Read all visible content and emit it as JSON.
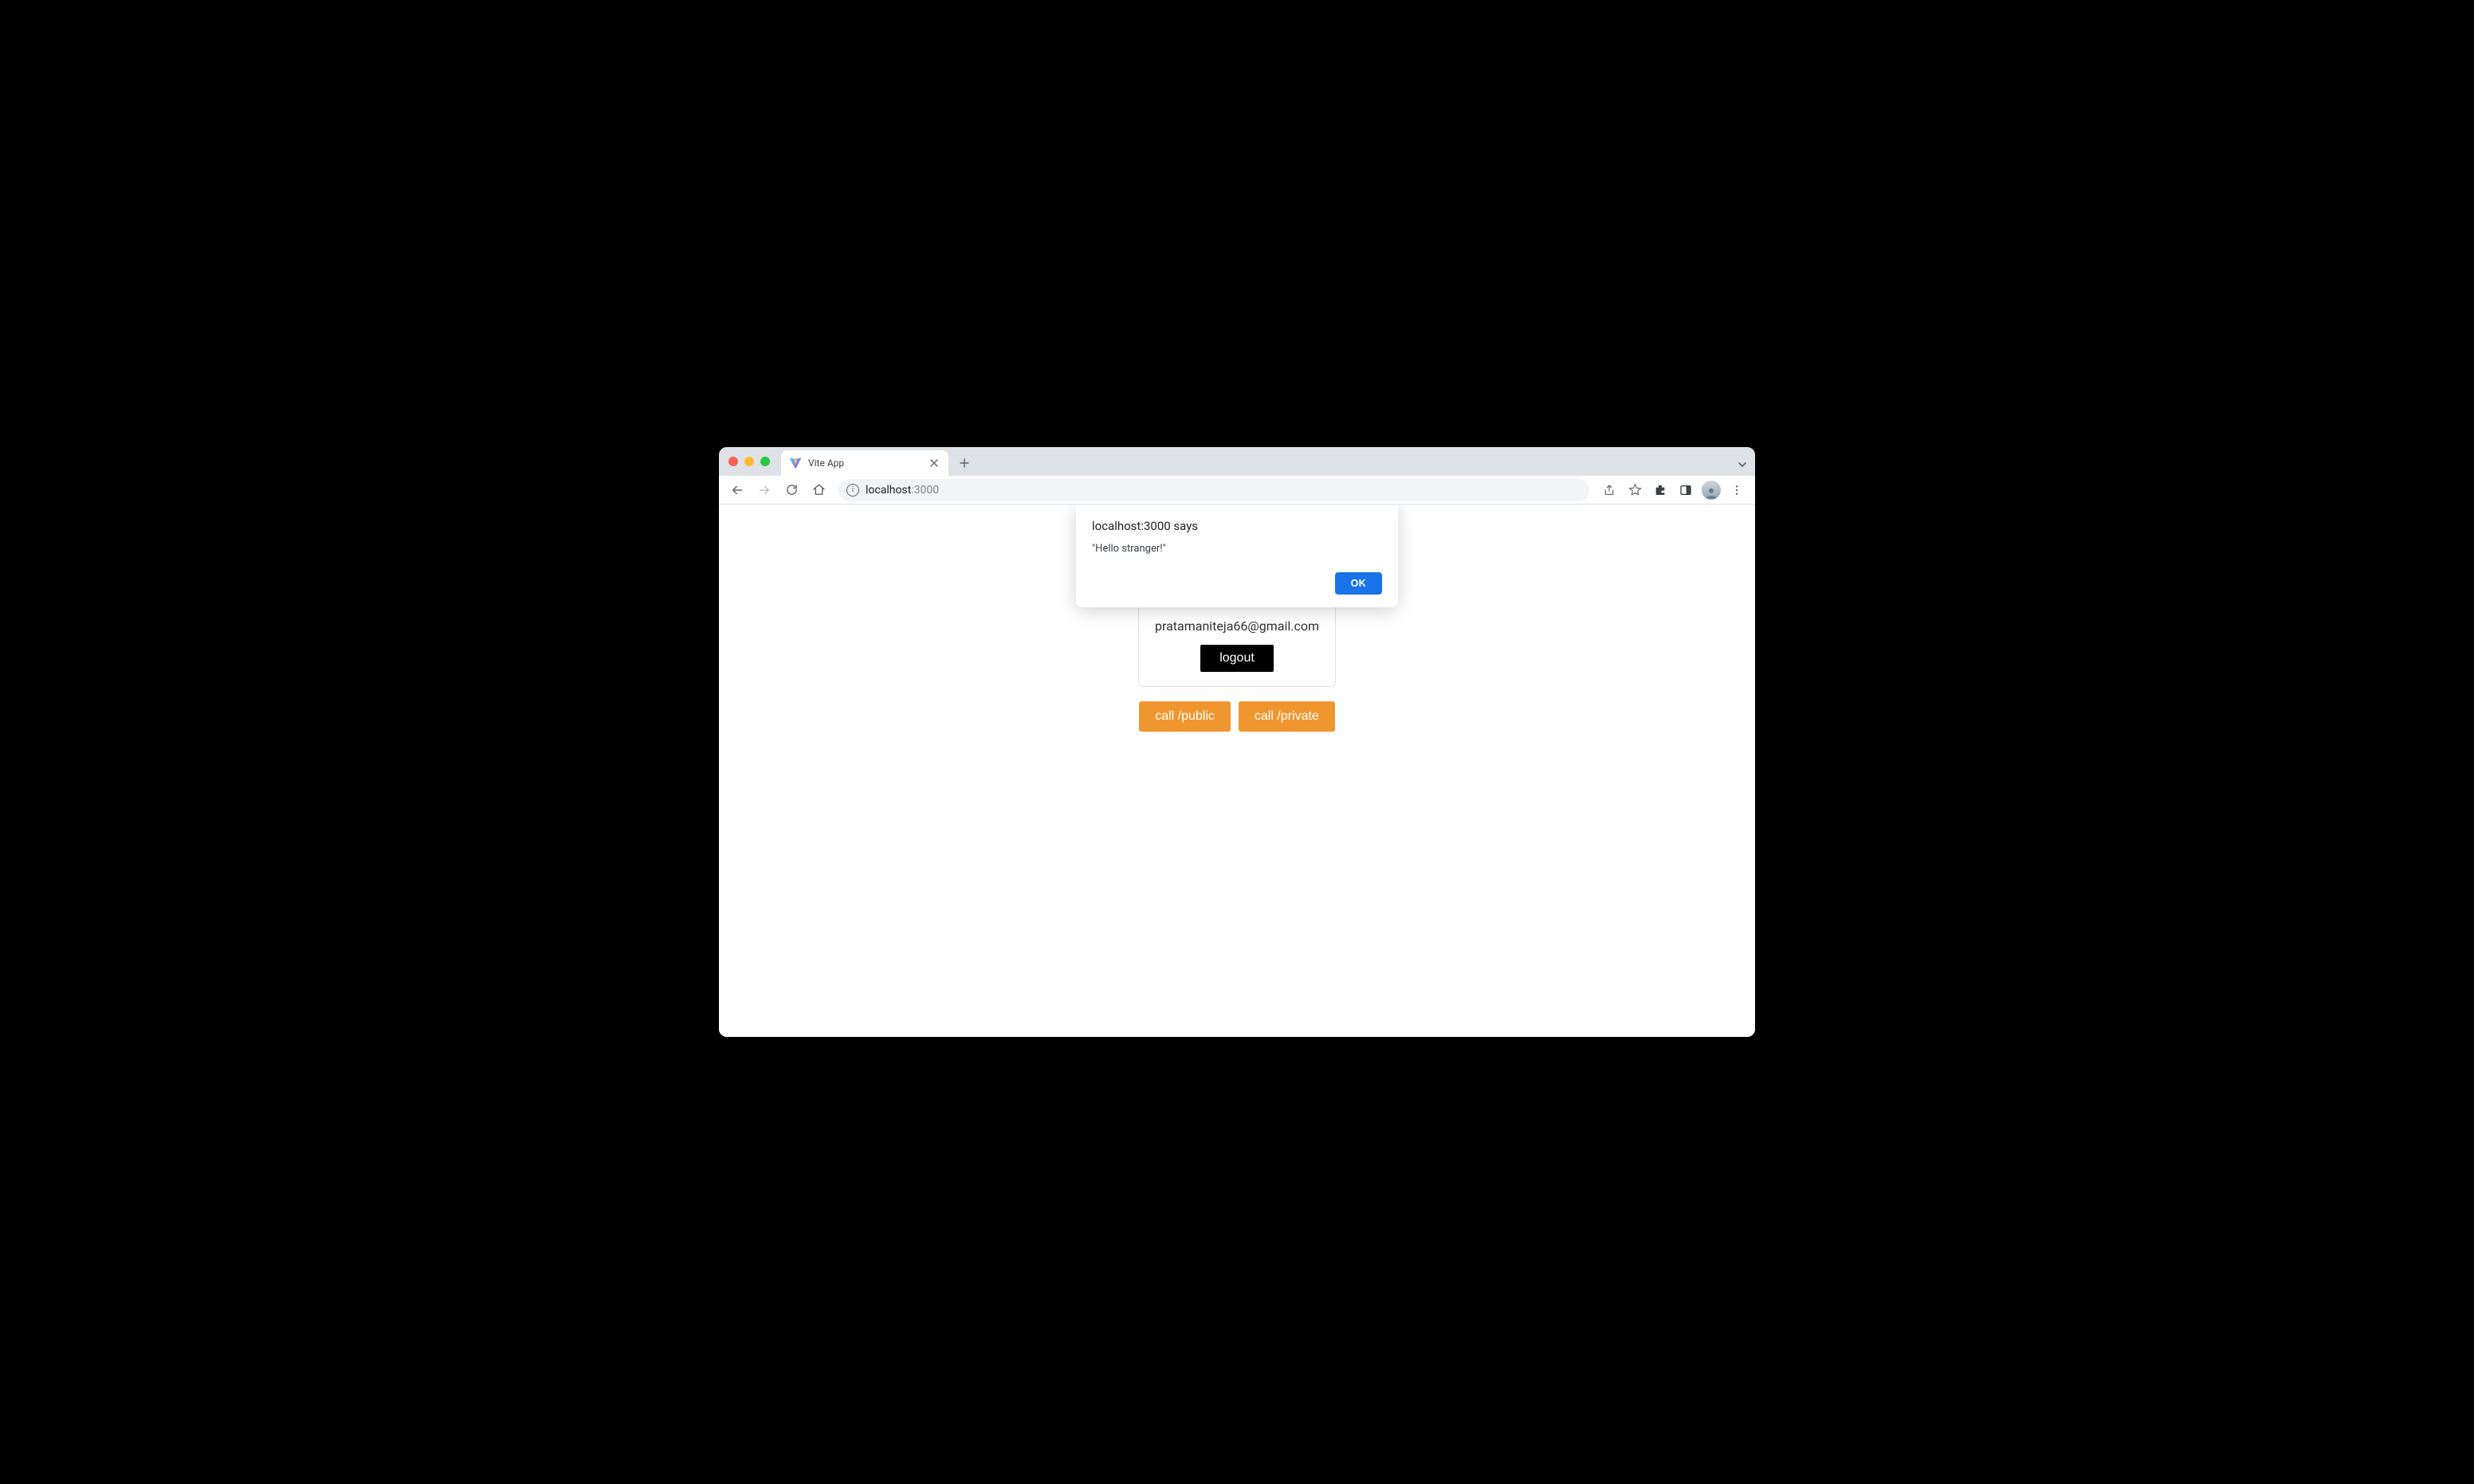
{
  "browser": {
    "tab_title": "Vite App",
    "url_host": "localhost",
    "url_port": ":3000"
  },
  "alert": {
    "title": "localhost:3000 says",
    "message": "\"Hello stranger!\"",
    "ok_label": "OK"
  },
  "page": {
    "email": "pratamaniteja66@gmail.com",
    "logout_label": "logout",
    "call_public_label": "call /public",
    "call_private_label": "call /private"
  }
}
